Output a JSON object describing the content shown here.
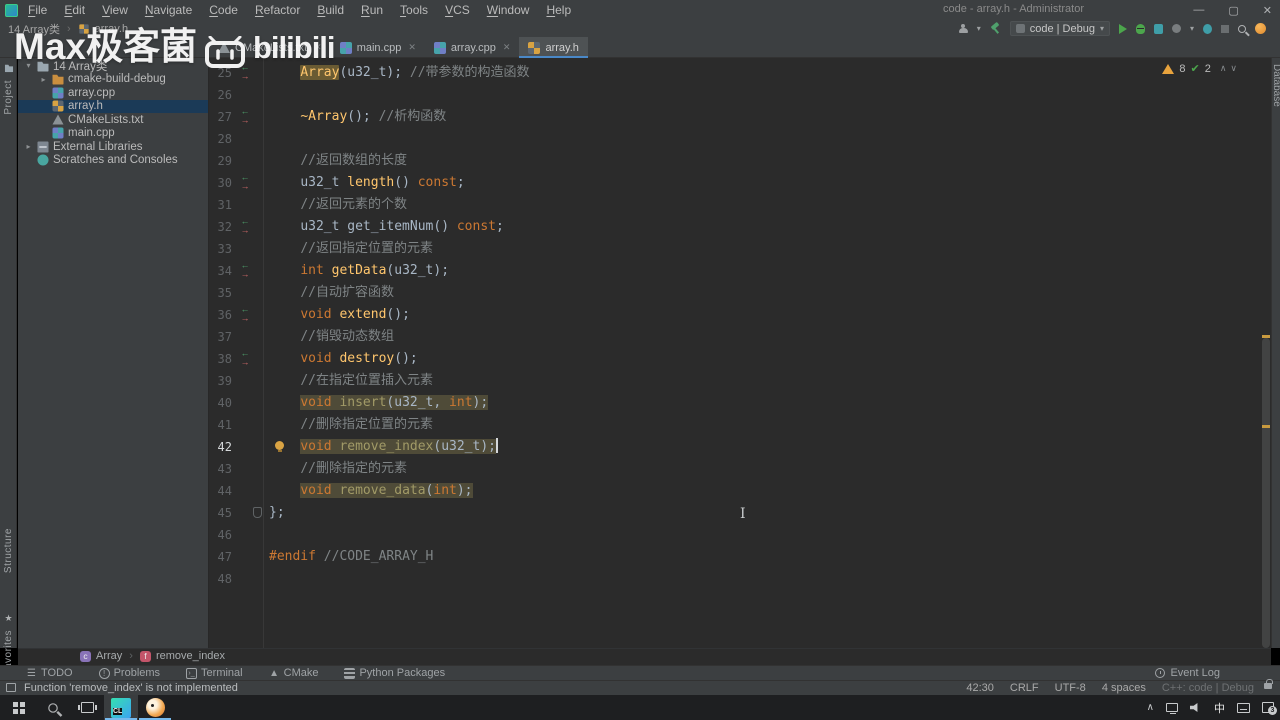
{
  "titlebar": {
    "menus": [
      "File",
      "Edit",
      "View",
      "Navigate",
      "Code",
      "Refactor",
      "Build",
      "Run",
      "Tools",
      "VCS",
      "Window",
      "Help"
    ],
    "title": "code - array.h - Administrator",
    "minimize": "—",
    "maximize": "▢",
    "close": "✕"
  },
  "navbar": {
    "crumb_project": "14 Array类",
    "crumb_file": "array.h",
    "run_config": "code | Debug"
  },
  "watermark": {
    "text": "Max极客菌",
    "brand": "bilibili"
  },
  "tabs": [
    {
      "label": "CMakeLists.txt",
      "icon": "cmake",
      "closable": true
    },
    {
      "label": "main.cpp",
      "icon": "cpp",
      "closable": true
    },
    {
      "label": "array.cpp",
      "icon": "cpp",
      "closable": true
    },
    {
      "label": "array.h",
      "icon": "h",
      "active": true
    }
  ],
  "stripes": {
    "left_top": "Project",
    "left_bottom": [
      "Structure",
      "Favorites"
    ],
    "right_top": "Database"
  },
  "project": {
    "tree": [
      {
        "label": "14 Array类",
        "icon": "folder",
        "chevron": "▾",
        "depth": 0
      },
      {
        "label": "cmake-build-debug",
        "icon": "folder excl",
        "chevron": "▸",
        "depth": 1
      },
      {
        "label": "array.cpp",
        "icon": "cpp",
        "chevron": "",
        "depth": 1
      },
      {
        "label": "array.h",
        "icon": "h",
        "chevron": "",
        "depth": 1,
        "selected": true
      },
      {
        "label": "CMakeLists.txt",
        "icon": "cmake",
        "chevron": "",
        "depth": 1
      },
      {
        "label": "main.cpp",
        "icon": "cpp",
        "chevron": "",
        "depth": 1
      },
      {
        "label": "External Libraries",
        "icon": "lib",
        "chevron": "▸",
        "depth": 0
      },
      {
        "label": "Scratches and Consoles",
        "icon": "scratch",
        "chevron": "",
        "depth": 0
      }
    ]
  },
  "editor": {
    "inspection": {
      "warnings": "8",
      "ok": "2"
    },
    "lines": [
      {
        "n": 25,
        "g": "ar",
        "t": [
          [
            "pl",
            "    "
          ],
          [
            "fn u",
            "Array"
          ],
          [
            "tx",
            "(u32_t); "
          ],
          [
            "cm",
            "//带参数的构造函数"
          ]
        ]
      },
      {
        "n": 26,
        "t": []
      },
      {
        "n": 27,
        "g": "ar",
        "t": [
          [
            "pl",
            "    "
          ],
          [
            "fn",
            "~Array"
          ],
          [
            "tx",
            "(); "
          ],
          [
            "cm",
            "//析构函数"
          ]
        ]
      },
      {
        "n": 28,
        "t": []
      },
      {
        "n": 29,
        "t": [
          [
            "pl",
            "    "
          ],
          [
            "cm",
            "//返回数组的长度"
          ]
        ]
      },
      {
        "n": 30,
        "g": "ar",
        "t": [
          [
            "pl",
            "    "
          ],
          [
            "tx",
            "u32_t "
          ],
          [
            "fn",
            "length"
          ],
          [
            "tx",
            "() "
          ],
          [
            "kw",
            "const"
          ],
          [
            "tx",
            ";"
          ]
        ]
      },
      {
        "n": 31,
        "t": [
          [
            "pl",
            "    "
          ],
          [
            "cm",
            "//返回元素的个数"
          ]
        ]
      },
      {
        "n": 32,
        "g": "ar",
        "t": [
          [
            "pl",
            "    "
          ],
          [
            "tx",
            "u32_t get_itemNum() "
          ],
          [
            "kw",
            "const"
          ],
          [
            "tx",
            ";"
          ]
        ]
      },
      {
        "n": 33,
        "t": [
          [
            "pl",
            "    "
          ],
          [
            "cm",
            "//返回指定位置的元素"
          ]
        ]
      },
      {
        "n": 34,
        "g": "ar",
        "t": [
          [
            "pl",
            "    "
          ],
          [
            "kw",
            "int "
          ],
          [
            "fn",
            "getData"
          ],
          [
            "tx",
            "(u32_t);"
          ]
        ]
      },
      {
        "n": 35,
        "t": [
          [
            "pl",
            "    "
          ],
          [
            "cm",
            "//自动扩容函数"
          ]
        ]
      },
      {
        "n": 36,
        "g": "ar",
        "t": [
          [
            "pl",
            "    "
          ],
          [
            "kw",
            "void "
          ],
          [
            "fn",
            "extend"
          ],
          [
            "tx",
            "();"
          ]
        ]
      },
      {
        "n": 37,
        "t": [
          [
            "pl",
            "    "
          ],
          [
            "cm",
            "//销毁动态数组"
          ]
        ]
      },
      {
        "n": 38,
        "g": "ar",
        "t": [
          [
            "pl",
            "    "
          ],
          [
            "kw",
            "void "
          ],
          [
            "fn",
            "destroy"
          ],
          [
            "tx",
            "();"
          ]
        ]
      },
      {
        "n": 39,
        "t": [
          [
            "pl",
            "    "
          ],
          [
            "cm",
            "//在指定位置插入元素"
          ]
        ]
      },
      {
        "n": 40,
        "t": [
          [
            "pl",
            "    "
          ],
          [
            "kw h",
            "void "
          ],
          [
            "fnd h",
            "insert"
          ],
          [
            "tx h",
            "(u32_t, "
          ],
          [
            "kw h",
            "int"
          ],
          [
            "tx h",
            ");"
          ]
        ]
      },
      {
        "n": 41,
        "t": [
          [
            "pl",
            "    "
          ],
          [
            "cm",
            "//删除指定位置的元素"
          ]
        ]
      },
      {
        "n": 42,
        "g": "bulb",
        "cur": true,
        "caret": true,
        "t": [
          [
            "pl",
            "    "
          ],
          [
            "kw h",
            "void "
          ],
          [
            "fnd h",
            "remove_index"
          ],
          [
            "tx h",
            "(u32_t)"
          ],
          [
            "tx h",
            ";"
          ]
        ]
      },
      {
        "n": 43,
        "t": [
          [
            "pl",
            "    "
          ],
          [
            "cm",
            "//删除指定的元素"
          ]
        ]
      },
      {
        "n": 44,
        "t": [
          [
            "pl",
            "    "
          ],
          [
            "kw h",
            "void "
          ],
          [
            "fnd h",
            "remove_data"
          ],
          [
            "tx h",
            "("
          ],
          [
            "kw h",
            "int"
          ],
          [
            "tx h",
            ");"
          ]
        ]
      },
      {
        "n": 45,
        "g": "fold",
        "t": [
          [
            "tx",
            "};"
          ]
        ]
      },
      {
        "n": 46,
        "t": []
      },
      {
        "n": 47,
        "t": [
          [
            "kw",
            "#endif "
          ],
          [
            "cm",
            "//CODE_ARRAY_H"
          ]
        ]
      },
      {
        "n": 48,
        "t": []
      }
    ]
  },
  "breadcrumbs": [
    {
      "icon": "cls",
      "glyph": "c",
      "label": "Array"
    },
    {
      "icon": "fnc",
      "glyph": "f",
      "label": "remove_index"
    }
  ],
  "toolwindows": [
    {
      "icon": "todo",
      "label": "TODO"
    },
    {
      "icon": "problems",
      "label": "Problems"
    },
    {
      "icon": "terminal",
      "label": "Terminal"
    },
    {
      "icon": "cmake",
      "label": "CMake"
    },
    {
      "icon": "pkg",
      "label": "Python Packages"
    }
  ],
  "eventlog": {
    "label": "Event Log"
  },
  "statusbar": {
    "message": "Function 'remove_index' is not implemented",
    "items": [
      "42:30",
      "CRLF",
      "UTF-8",
      "4 spaces"
    ],
    "context": "C++: code | Debug"
  },
  "taskbar": {
    "ime": "中",
    "notif_badge": "3",
    "clion_glyph": "CL"
  }
}
